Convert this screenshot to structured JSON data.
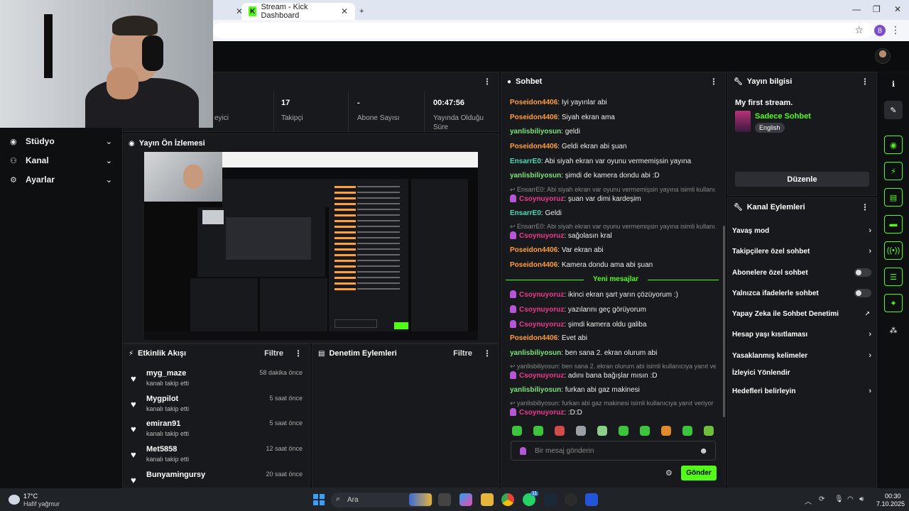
{
  "browser": {
    "tab_title": "Stream - Kick Dashboard",
    "tab_close": "✕",
    "new_tab": "+",
    "favicon": "K",
    "profile_initial": "B"
  },
  "sidebar": {
    "items": [
      {
        "label": "Stüdyo",
        "icon": "studio-icon"
      },
      {
        "label": "Kanal",
        "icon": "channel-icon"
      },
      {
        "label": "Ayarlar",
        "icon": "gear-icon"
      }
    ]
  },
  "stats": {
    "viewers_label": "eyici",
    "followers_value": "17",
    "followers_label": "Takipçi",
    "subs_value": "-",
    "subs_label": "Abone Sayısı",
    "uptime_value": "00:47:56",
    "uptime_label_1": "Yayında Olduğu",
    "uptime_label_2": "Süre"
  },
  "preview": {
    "title": "Yayın Ön İzlemesi"
  },
  "activity": {
    "title": "Etkinlik Akışı",
    "filter": "Filtre",
    "items": [
      {
        "name": "myg_maze",
        "sub": "kanalı takip etti",
        "time": "58 dakika önce"
      },
      {
        "name": "Mygpilot",
        "sub": "kanalı takip etti",
        "time": "5 saat önce"
      },
      {
        "name": "emiran91",
        "sub": "kanalı takip etti",
        "time": "5 saat önce"
      },
      {
        "name": "Met5858",
        "sub": "kanalı takip etti",
        "time": "12 saat önce"
      },
      {
        "name": "Bunyamingursy",
        "sub": "kanalı takip etti",
        "time": "20 saat önce"
      }
    ]
  },
  "moderation": {
    "title": "Denetim Eylemleri",
    "filter": "Filtre"
  },
  "chat": {
    "title": "Sohbet",
    "new_messages": "Yeni mesajlar",
    "placeholder": "Bir mesaj gönderin",
    "send": "Gönder",
    "messages": [
      {
        "user": "Poseidon4406",
        "text": ": İyi yayınlar abi",
        "color": "orange"
      },
      {
        "user": "Poseidon4406",
        "text": ": Siyah ekran ama",
        "color": "orange"
      },
      {
        "user": "yanlisbiliyosun",
        "text": ": geldi",
        "color": "green"
      },
      {
        "user": "Poseidon4406",
        "text": ": Geldi ekran abi şuan",
        "color": "orange"
      },
      {
        "user": "EnsarrE0",
        "text": ": Abi siyah ekran var oyunu vermemişsin yayına",
        "color": "teal"
      },
      {
        "user": "yanlisbiliyosun",
        "text": ": şimdi de kamera dondu abi :D",
        "color": "green"
      }
    ],
    "reply1": "↩ EnsarrE0: Abi siyah ekran var oyunu vermemişsin yayına isimli kullanı...",
    "msg7": {
      "user": "Csoynuyoruz",
      "text": ": şuan var dimi kardeşim"
    },
    "msg8": {
      "user": "EnsarrE0",
      "text": ": Geldi"
    },
    "reply2": "↩ EnsarrE0: Abi siyah ekran var oyunu vermemişsin yayına isimli kullanı...",
    "msg9": {
      "user": "Csoynuyoruz",
      "text": ": sağolasın kral"
    },
    "msg10": {
      "user": "Poseidon4406",
      "text": ": Var ekran abi"
    },
    "msg11": {
      "user": "Poseidon4406",
      "text": ": Kamera dondu ama abi şuan"
    },
    "msg12": {
      "user": "Csoynuyoruz",
      "text": ": ikinci ekran şart yarın çözüyorum :)"
    },
    "msg13": {
      "user": "Csoynuyoruz",
      "text": ": yazılarını geç görüyorum"
    },
    "msg14": {
      "user": "Csoynuyoruz",
      "text": ": şimdi kamera oldu galiba"
    },
    "msg15": {
      "user": "Poseidon4406",
      "text": ": Evet abi"
    },
    "msg16": {
      "user": "yanlisbiliyosun",
      "text": ": ben sana 2. ekran olurum abi"
    },
    "reply3": "↩ yanlisbiliyosun: ben sana 2. ekran olurum abi isimli kullanıcıya yanıt ve...",
    "msg17": {
      "user": "Csoynuyoruz",
      "text": ": adını bana bağışlar mısın :D"
    },
    "msg18": {
      "user": "yanlisbiliyosun",
      "text": ": furkan abi gaz makinesi"
    },
    "reply4": "↩ yanlisbiliyosun: furkan abi gaz makinesi isimli kullanıcıya yanıt veriyor",
    "msg19": {
      "user": "Csoynuyoruz",
      "text": ": :D:D"
    }
  },
  "stream_info": {
    "title": "Yayın bilgisi",
    "stream_title": "My first stream.",
    "category": "Sadece Sohbet",
    "language": "English",
    "edit": "Düzenle"
  },
  "channel_actions": {
    "title": "Kanal Eylemleri",
    "items": [
      {
        "label": "Yavaş mod",
        "kind": "chevron"
      },
      {
        "label": "Takipçilere özel sohbet",
        "kind": "chevron"
      },
      {
        "label": "Abonelere özel sohbet",
        "kind": "toggle"
      },
      {
        "label": "Yalnızca ifadelerle sohbet",
        "kind": "toggle"
      },
      {
        "label": "Yapay Zeka ile Sohbet Denetimi",
        "kind": "external"
      },
      {
        "label": "Hesap yaşı kısıtlaması",
        "kind": "chevron"
      },
      {
        "label": "Yasaklanmış kelimeler",
        "kind": "chevron"
      },
      {
        "label": "İzleyici Yönlendir",
        "kind": "none"
      },
      {
        "label": "Hedefleri belirleyin",
        "kind": "chevron"
      }
    ]
  },
  "taskbar": {
    "temp": "17°C",
    "weather": "Hafif yağmur",
    "search": "Ara",
    "time": "00:30",
    "date": "7.10.2025",
    "whatsapp_badge": "11"
  },
  "colors": {
    "accent": "#53fc18",
    "panel": "#18191c",
    "bg": "#0e0f11"
  }
}
